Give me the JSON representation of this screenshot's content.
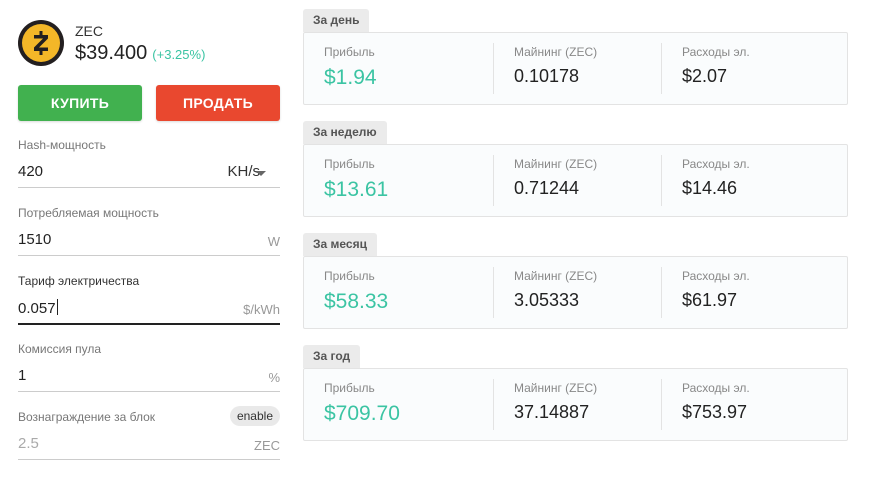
{
  "coin": {
    "symbol": "ZEC",
    "price": "$39.400",
    "change": "(+3.25%)",
    "logo_icon": "zcash-logo-icon",
    "logo_letter": "ⓩ"
  },
  "actions": {
    "buy_label": "КУПИТЬ",
    "sell_label": "ПРОДАТЬ"
  },
  "fields": {
    "hashrate": {
      "label": "Hash-мощность",
      "value": "420",
      "unit": "KH/s"
    },
    "power": {
      "label": "Потребляемая мощность",
      "value": "1510",
      "unit": "W"
    },
    "tariff": {
      "label": "Тариф электричества",
      "value": "0.057",
      "unit": "$/kWh"
    },
    "pool_fee": {
      "label": "Комиссия пула",
      "value": "1",
      "unit": "%"
    },
    "block_reward": {
      "label": "Вознаграждение за блок",
      "value": "2.5",
      "unit": "ZEC",
      "badge": "enable"
    }
  },
  "columns": {
    "profit": "Прибыль",
    "mining": "Майнинг (ZEC)",
    "costs": "Расходы эл."
  },
  "periods": [
    {
      "name": "За день",
      "profit": "$1.94",
      "mining": "0.10178",
      "costs": "$2.07"
    },
    {
      "name": "За неделю",
      "profit": "$13.61",
      "mining": "0.71244",
      "costs": "$14.46"
    },
    {
      "name": "За месяц",
      "profit": "$58.33",
      "mining": "3.05333",
      "costs": "$61.97"
    },
    {
      "name": "За год",
      "profit": "$709.70",
      "mining": "37.14887",
      "costs": "$753.97"
    }
  ],
  "colors": {
    "accent_green": "#3bc4a3",
    "buy": "#41b14f",
    "sell": "#e9482f",
    "logo_gold": "#f4b728"
  }
}
